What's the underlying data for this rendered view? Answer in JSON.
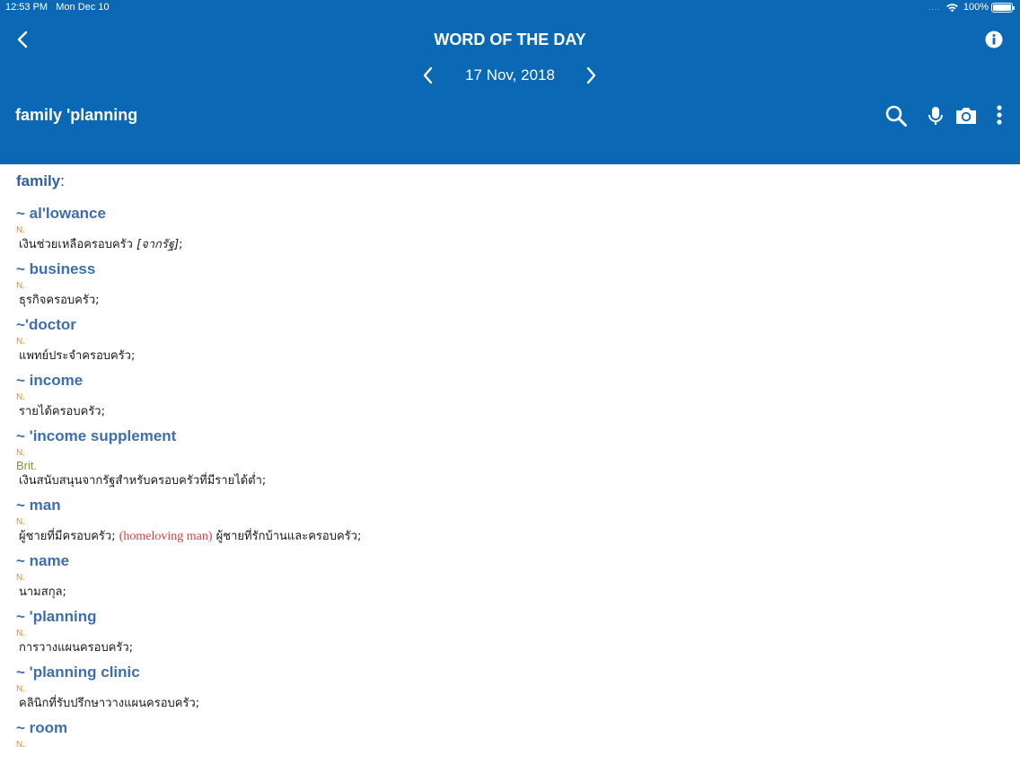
{
  "status": {
    "time": "12:53 PM",
    "date": "Mon Dec 10",
    "signal": "....",
    "battery": "100%"
  },
  "header": {
    "title": "WORD OF THE DAY",
    "date": "17 Nov, 2018",
    "headword": "family 'planning"
  },
  "icons": {
    "back": "chevron-left-icon",
    "info": "info-circle-icon",
    "prev": "chevron-left-icon",
    "next": "chevron-right-icon",
    "search": "search-icon",
    "mic": "microphone-icon",
    "camera": "camera-icon",
    "more": "more-vertical-icon"
  },
  "colors": {
    "header_bg": "#0a68b4",
    "phrase": "#3f6eb0",
    "pos": "#e28a2f",
    "region": "#7a9b3b",
    "example": "#d04040"
  },
  "content": {
    "base_word": "family",
    "base_colon": ":",
    "entries": [
      {
        "phrase": "~ al'lowance",
        "pos": "N.",
        "def_main": "เงินช่วยเหลือครอบครัว ",
        "def_italic": "[จากรัฐ]",
        "def_end": ";"
      },
      {
        "phrase": "~ business",
        "pos": "N.",
        "def_main": "ธุรกิจครอบครัว;"
      },
      {
        "phrase": "~'doctor",
        "pos": "N.",
        "def_main": "แพทย์ประจำครอบครัว;"
      },
      {
        "phrase": "~ income",
        "pos": "N.",
        "def_main": "รายได้ครอบครัว;"
      },
      {
        "phrase": "~ 'income supplement",
        "pos": "N.",
        "region": "Brit.",
        "def_main": "เงินสนับสนุนจากรัฐสำหรับครอบครัวที่มีรายได้ต่ำ;"
      },
      {
        "phrase": "~ man",
        "pos": "N.",
        "def_main": "ผู้ชายที่มีครอบครัว; ",
        "example": "(homeloving man)",
        "def_end": " ผู้ชายที่รักบ้านและครอบครัว;"
      },
      {
        "phrase": "~ name",
        "pos": "N.",
        "def_main": "นามสกุล;"
      },
      {
        "phrase": "~ 'planning",
        "pos": "N.",
        "def_main": "การวางแผนครอบครัว;"
      },
      {
        "phrase": "~ 'planning clinic",
        "pos": "N.",
        "def_main": "คลินิกที่รับปรึกษาวางแผนครอบครัว;"
      },
      {
        "phrase": "~ room",
        "pos": "N."
      }
    ]
  }
}
